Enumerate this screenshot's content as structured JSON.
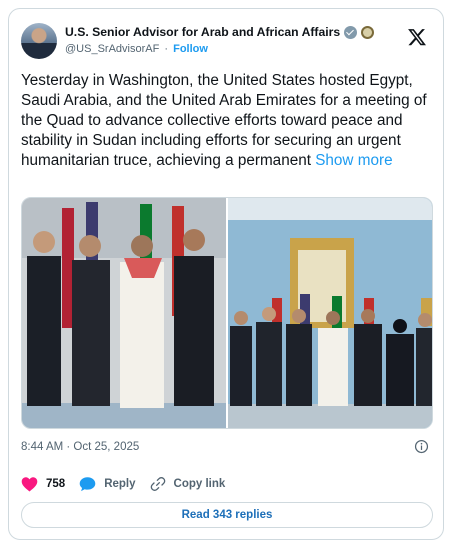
{
  "account": {
    "display_name": "U.S. Senior Advisor for Arab and African Affairs",
    "handle": "@US_SrAdvisorAF",
    "separator": "·",
    "follow_label": "Follow",
    "icons": [
      "verified-badge-icon",
      "agency-seal-icon",
      "x-logo-icon"
    ]
  },
  "post": {
    "text": "Yesterday in Washington, the United States hosted Egypt, Saudi Arabia, and the United Arab Emirates for a meeting of the Quad to advance collective efforts toward peace and stability in Sudan including efforts for securing an urgent humanitarian truce, achieving a permanent ",
    "show_more": "Show more",
    "timestamp": "8:44 AM · Oct 25, 2025"
  },
  "actions": {
    "like_count": "758",
    "reply_label": "Reply",
    "copy_link_label": "Copy link",
    "read_replies": "Read 343 replies"
  },
  "colors": {
    "accent": "#1d9bf0",
    "like": "#f91880",
    "text": "#0f1419",
    "muted": "#536471",
    "border": "#cfd9de"
  }
}
